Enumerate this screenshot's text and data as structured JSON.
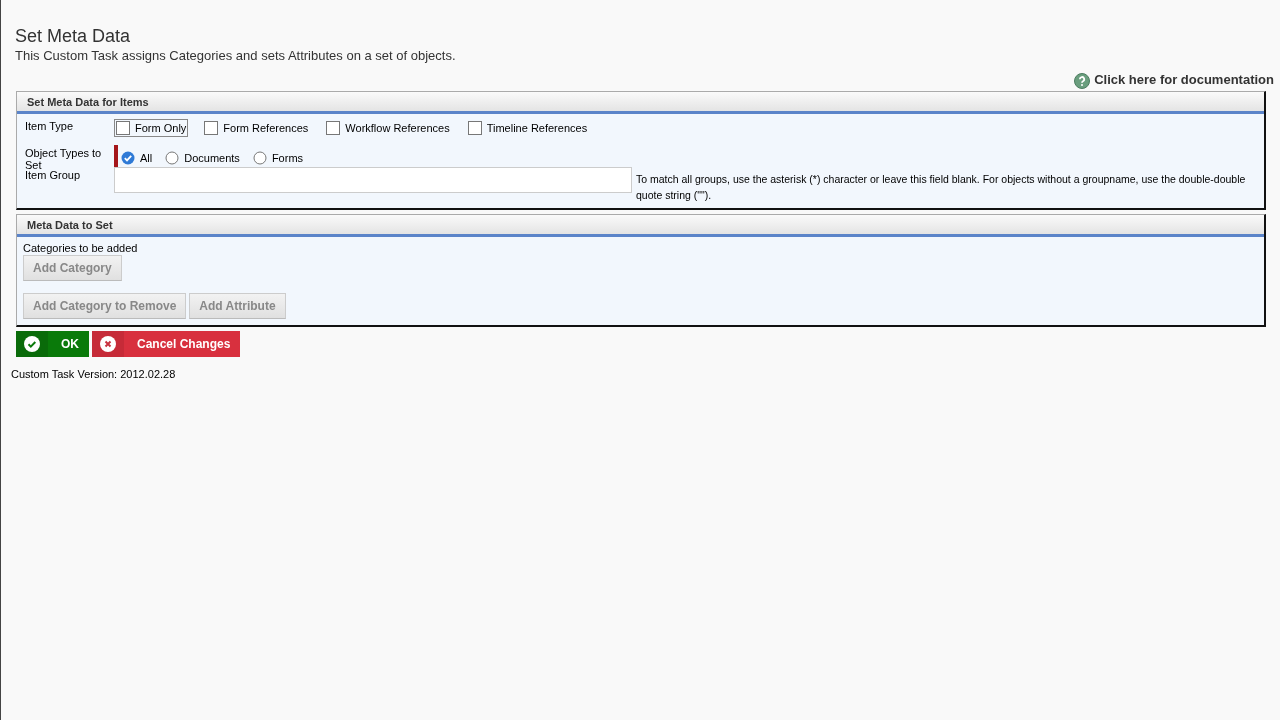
{
  "page": {
    "title": "Set Meta Data",
    "description": "This Custom Task assigns Categories and sets Attributes on a set of objects.",
    "doc_link": "Click here for documentation"
  },
  "items_panel": {
    "title": "Set Meta Data for Items",
    "item_type": {
      "label": "Item Type",
      "options": [
        {
          "label": "Form Only",
          "checked": false,
          "focused": true
        },
        {
          "label": "Form References",
          "checked": false,
          "focused": false
        },
        {
          "label": "Workflow References",
          "checked": false,
          "focused": false
        },
        {
          "label": "Timeline References",
          "checked": false,
          "focused": false
        }
      ]
    },
    "object_types": {
      "label": "Object Types to Set",
      "required": true,
      "options": [
        {
          "label": "All",
          "selected": true
        },
        {
          "label": "Documents",
          "selected": false
        },
        {
          "label": "Forms",
          "selected": false
        }
      ]
    },
    "item_group": {
      "label": "Item Group",
      "hint": "To match all groups, use the asterisk (*) character or leave this field blank. For objects without a groupname, use the double-double quote string (\"\")."
    }
  },
  "meta_panel": {
    "title": "Meta Data to Set",
    "categories_label": "Categories to be added",
    "add_category": "Add Category",
    "buttons": [
      "Add Category to Remove",
      "Add Attribute"
    ]
  },
  "actions": {
    "ok": "OK",
    "cancel": "Cancel Changes"
  },
  "version": "Custom Task Version: 2012.02.28"
}
